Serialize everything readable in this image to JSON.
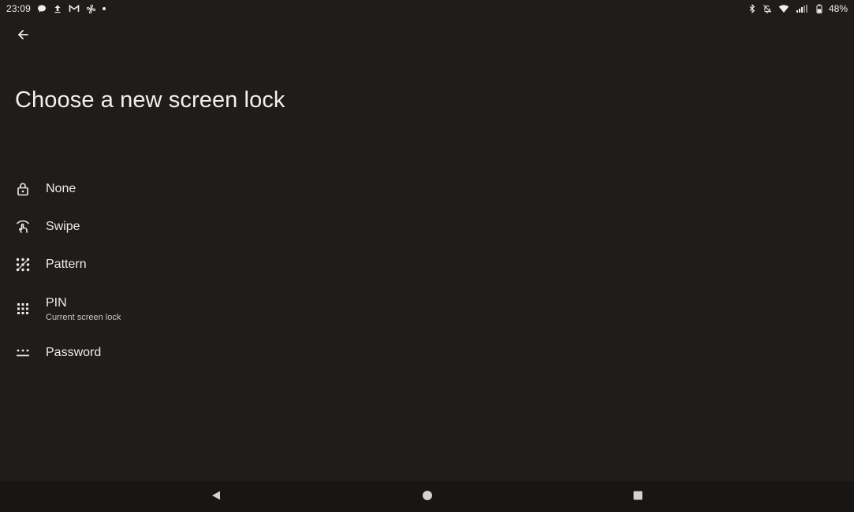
{
  "status_bar": {
    "time": "23:09",
    "battery": "48%",
    "left_icons": [
      "chat-bubble-icon",
      "upload-icon",
      "gmail-icon",
      "fan-icon",
      "more-notifications-dot-icon"
    ],
    "right_icons": [
      "bluetooth-icon",
      "notifications-off-icon",
      "wifi-icon",
      "signal-icon",
      "battery-icon"
    ]
  },
  "header": {
    "back_icon": "arrow-back-icon",
    "title": "Choose a new screen lock"
  },
  "options": [
    {
      "label": "None",
      "icon": "lock-open-icon",
      "summary": ""
    },
    {
      "label": "Swipe",
      "icon": "swipe-icon",
      "summary": ""
    },
    {
      "label": "Pattern",
      "icon": "pattern-icon",
      "summary": ""
    },
    {
      "label": "PIN",
      "icon": "pin-dots-icon",
      "summary": "Current screen lock"
    },
    {
      "label": "Password",
      "icon": "password-icon",
      "summary": ""
    }
  ],
  "nav_bar": {
    "back_icon": "nav-back-icon",
    "home_icon": "nav-home-icon",
    "recents_icon": "nav-recents-icon"
  },
  "colors": {
    "background": "#1f1c1a",
    "nav_background": "#181614",
    "text_primary": "#f0eae6",
    "text_secondary": "#cfc7c2"
  }
}
